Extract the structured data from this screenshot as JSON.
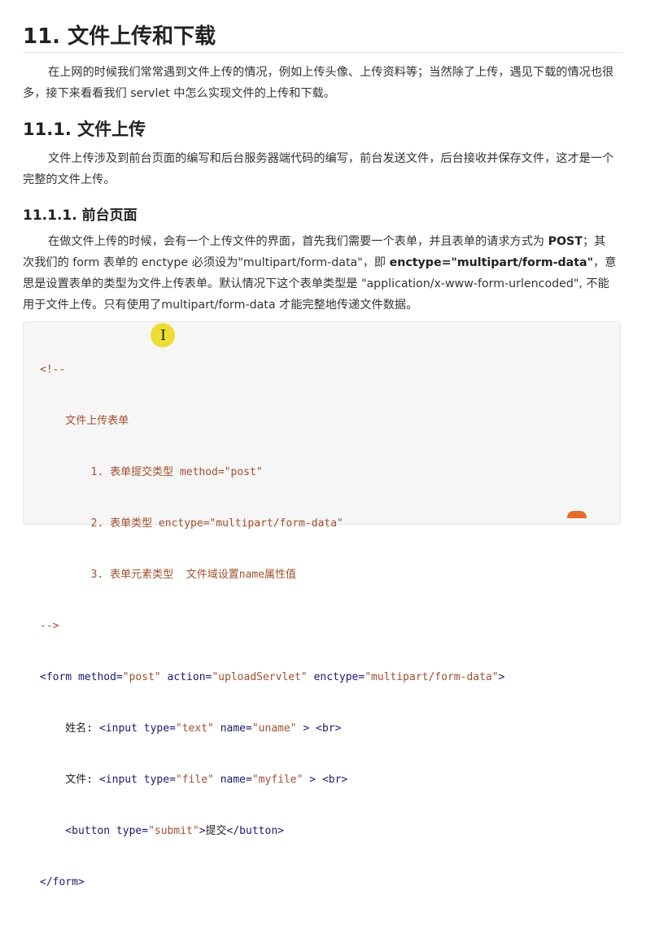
{
  "heading1": "11. 文件上传和下载",
  "intro": "在上网的时候我们常常遇到文件上传的情况，例如上传头像、上传资料等；当然除了上传，遇见下载的情况也很多，接下来看看我们 servlet 中怎么实现文件的上传和下载。",
  "heading2": "11.1. 文件上传",
  "upload_desc": "文件上传涉及到前台页面的编写和后台服务器端代码的编写，前台发送文件，后台接收并保存文件，这才是一个完整的文件上传。",
  "heading3": "11.1.1. 前台页面",
  "frontend_desc": {
    "part1": "在做文件上传的时候，会有一个上传文件的界面，首先我们需要一个表单，并且表单的请求方式为 ",
    "bold1": "POST",
    "part2": "；其次我们的 form 表单的 enctype 必须设为\"multipart/form-data\"，即 ",
    "bold2": "enctype=\"multipart/form-data\"",
    "part3": "，意思是设置表单的类型为文件上传表单。默认情况下这个表单类型是 \"application/x-www-form-urlencoded\", 不能用于文件上传。只有使用了multipart/form-data 才能完整地传递文件数据。"
  },
  "code": {
    "l1": "<!--",
    "l2": "    文件上传表单",
    "l3": "        1. 表单提交类型 method=\"post\"",
    "l4": "        2. 表单类型 enctype=\"multipart/form-data\"",
    "l5": "        3. 表单元素类型  文件域设置name属性值",
    "l6": "-->",
    "l7": {
      "t1": "<form ",
      "a1": "method=",
      "s1": "\"post\"",
      "a2": " action=",
      "s2": "\"uploadServlet\"",
      "a3": " enctype=",
      "s3": "\"multipart/form-data\"",
      "t2": ">"
    },
    "l8": {
      "x1": "    姓名: ",
      "t1": "<input ",
      "a1": "type=",
      "s1": "\"text\"",
      "a2": " name=",
      "s2": "\"uname\"",
      "t2": " > <br>"
    },
    "l9": {
      "x1": "    文件: ",
      "t1": "<input ",
      "a1": "type=",
      "s1": "\"file\"",
      "a2": " name=",
      "s2": "\"myfile\"",
      "t2": " > <br>"
    },
    "l10": {
      "t1": "    <button ",
      "a1": "type=",
      "s1": "\"submit\"",
      "t2": ">",
      "x1": "提交",
      "t3": "</button>"
    },
    "l11": "</form>"
  },
  "colors": {
    "comment": "#a0502d",
    "tag": "#1a1a6e",
    "string": "#a0502d",
    "code_bg": "#f6f6f6",
    "cursor_highlight": "#ecdc1e"
  },
  "icons": {
    "cursor": "text-cursor-icon"
  }
}
